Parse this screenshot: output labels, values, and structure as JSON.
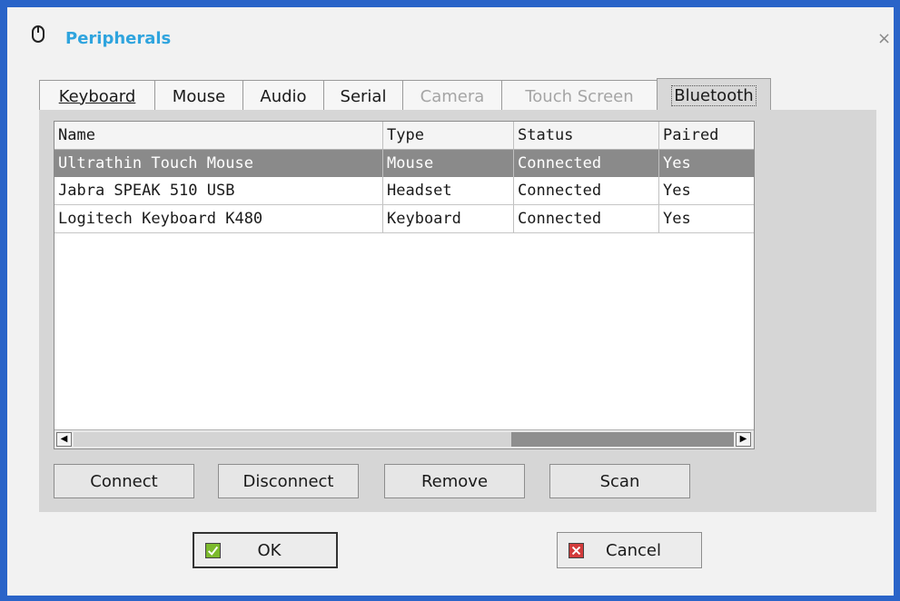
{
  "window": {
    "title": "Peripherals",
    "close_glyph": "×"
  },
  "icons": {
    "title": "mouse-icon",
    "close": "close-icon",
    "ok": "checkmark-icon",
    "cancel": "x-icon"
  },
  "tabs": [
    {
      "label": "Keyboard",
      "state": "enabled"
    },
    {
      "label": "Mouse",
      "state": "enabled"
    },
    {
      "label": "Audio",
      "state": "enabled"
    },
    {
      "label": "Serial",
      "state": "enabled"
    },
    {
      "label": "Camera",
      "state": "disabled"
    },
    {
      "label": "Touch Screen",
      "state": "disabled"
    },
    {
      "label": "Bluetooth",
      "state": "active"
    }
  ],
  "table": {
    "columns": [
      "Name",
      "Type",
      "Status",
      "Paired"
    ],
    "rows": [
      {
        "name": "Ultrathin Touch Mouse",
        "type": "Mouse",
        "status": "Connected",
        "paired": "Yes",
        "selected": true
      },
      {
        "name": "Jabra SPEAK 510 USB",
        "type": "Headset",
        "status": "Connected",
        "paired": "Yes",
        "selected": false
      },
      {
        "name": "Logitech Keyboard K480",
        "type": "Keyboard",
        "status": "Connected",
        "paired": "Yes",
        "selected": false
      }
    ],
    "scroll_left_glyph": "◀",
    "scroll_right_glyph": "▶"
  },
  "buttons": {
    "connect": "Connect",
    "disconnect": "Disconnect",
    "remove": "Remove",
    "scan": "Scan"
  },
  "dialog": {
    "ok": "OK",
    "cancel": "Cancel"
  },
  "colors": {
    "title": "#2fa4de",
    "selected_row": "#8a8a8a",
    "frame": "#2a64c8"
  }
}
